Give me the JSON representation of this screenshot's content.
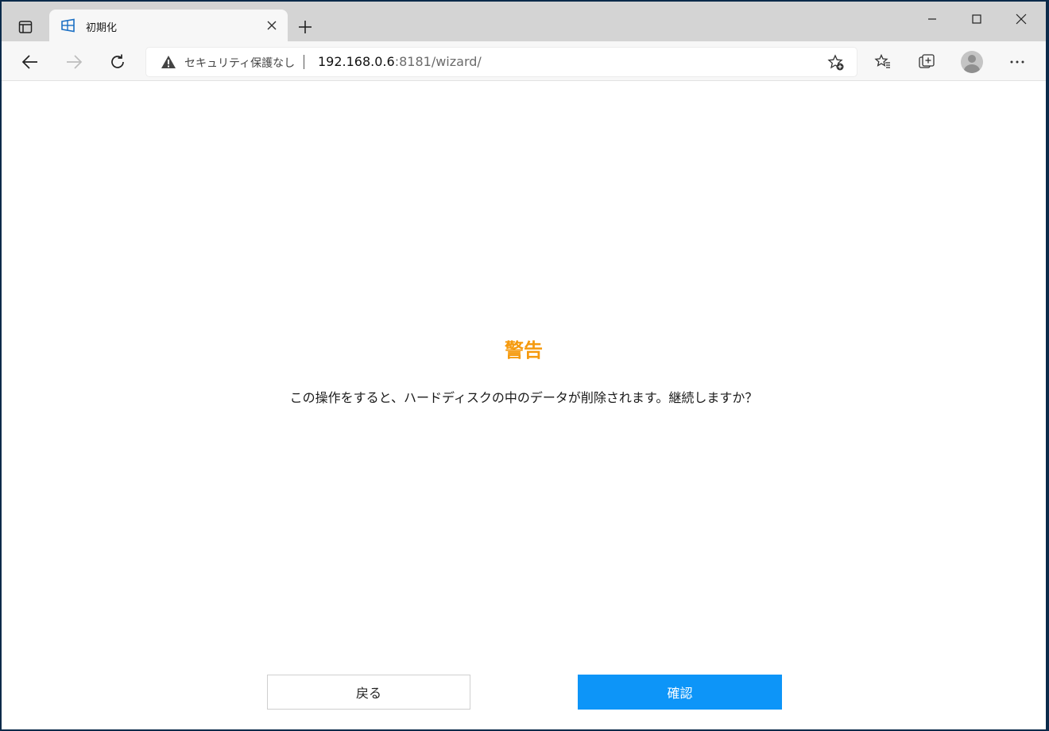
{
  "browser": {
    "tab": {
      "title": "初期化"
    },
    "address_bar": {
      "security_label": "セキュリティ保護なし",
      "url_host": "192.168.0.6",
      "url_rest": ":8181/wizard/"
    },
    "icons": {
      "tab_actions": "tab-actions-icon",
      "favicon": "windows-logo-icon",
      "close_tab": "close-icon",
      "new_tab": "plus-icon",
      "minimize": "minimize-icon",
      "maximize": "maximize-icon",
      "close_window": "close-icon",
      "back": "back-arrow-icon",
      "forward": "forward-arrow-icon",
      "refresh": "refresh-icon",
      "warning": "warning-triangle-icon",
      "add_favorite": "star-plus-icon",
      "favorites": "favorites-icon",
      "collections": "collections-icon",
      "profile": "profile-avatar-icon",
      "menu": "more-dots-icon"
    }
  },
  "dialog": {
    "title": "警告",
    "message": "この操作をすると、ハードディスクの中のデータが削除されます。継続しますか？",
    "back_label": "戻る",
    "confirm_label": "確認"
  },
  "colors": {
    "title": "#f59a0e",
    "confirm_button": "#0d95f8",
    "tab_strip": "#d4d4d4"
  }
}
